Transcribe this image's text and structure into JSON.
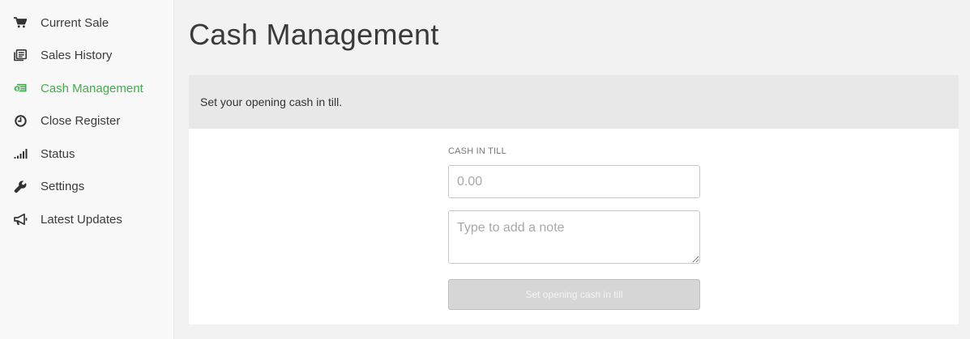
{
  "sidebar": {
    "items": [
      {
        "label": "Current Sale",
        "icon": "cart-icon",
        "active": false
      },
      {
        "label": "Sales History",
        "icon": "history-icon",
        "active": false
      },
      {
        "label": "Cash Management",
        "icon": "cash-icon",
        "active": true
      },
      {
        "label": "Close Register",
        "icon": "clock-icon",
        "active": false
      },
      {
        "label": "Status",
        "icon": "signal-icon",
        "active": false
      },
      {
        "label": "Settings",
        "icon": "wrench-icon",
        "active": false
      },
      {
        "label": "Latest Updates",
        "icon": "megaphone-icon",
        "active": false
      }
    ]
  },
  "main": {
    "title": "Cash Management",
    "banner_text": "Set your opening cash in till.",
    "form": {
      "cash_label": "CASH IN TILL",
      "cash_placeholder": "0.00",
      "cash_value": "",
      "note_placeholder": "Type to add a note",
      "note_value": "",
      "submit_label": "Set opening cash in till",
      "submit_disabled": true
    }
  },
  "colors": {
    "accent": "#3fae49",
    "sidebar_bg": "#f8f8f8",
    "page_bg": "#f2f2f2",
    "banner_bg": "#e8e8e8",
    "button_disabled_bg": "#d6d6d6"
  }
}
